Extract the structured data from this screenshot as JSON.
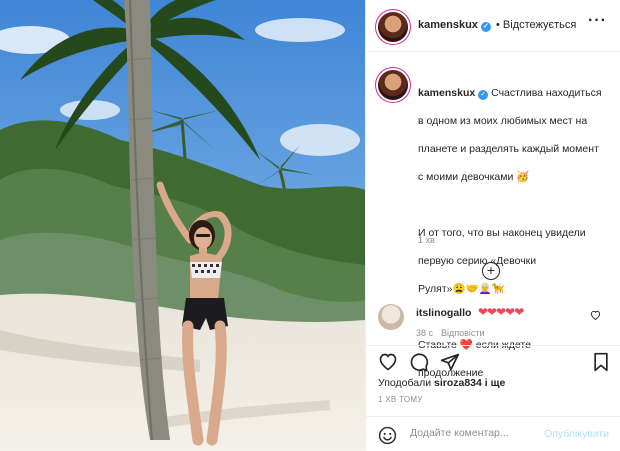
{
  "post": {
    "username": "kamenskux",
    "follow_status": "• Відстежується",
    "more_icon": "more-horizontal-icon",
    "verified_icon": "verified-badge-icon"
  },
  "caption": {
    "username": "kamenskux",
    "lines": [
      "Счастлива находиться",
      "в одном из моих любимых мест на",
      "планете и разделять каждый момент",
      "с моими девочками 🥳",
      "",
      "И от того, что вы наконец увидели",
      "первую серию «Девочки",
      "Рулят»😩🤝👩‍🦳🦮",
      "",
      "Ставьте ❤️ если ждете",
      "продолжение"
    ],
    "time": "1 хв"
  },
  "load_more_icon": "plus-circle-icon",
  "comment": {
    "username": "itslinogallo",
    "text": "❤❤❤❤❤",
    "time": "38 с",
    "reply_label": "Відповісти",
    "like_icon": "heart-outline-icon"
  },
  "actions": {
    "icons": [
      "heart-outline-icon",
      "comment-icon",
      "share-icon",
      "bookmark-icon"
    ]
  },
  "likes": {
    "prefix": "Уподобали",
    "user": "siroza834",
    "suffix": "і ще"
  },
  "timeago": "1 ХВ ТОМУ",
  "add_comment": {
    "placeholder": "Додайте коментар...",
    "publish_label": "Опублікувати",
    "emoji_icon": "emoji-smile-icon"
  },
  "colors": {
    "verified": "#3897f0",
    "publish_disabled": "#b2dffc",
    "heart": "#ed4956",
    "muted": "#8e8e8e"
  }
}
